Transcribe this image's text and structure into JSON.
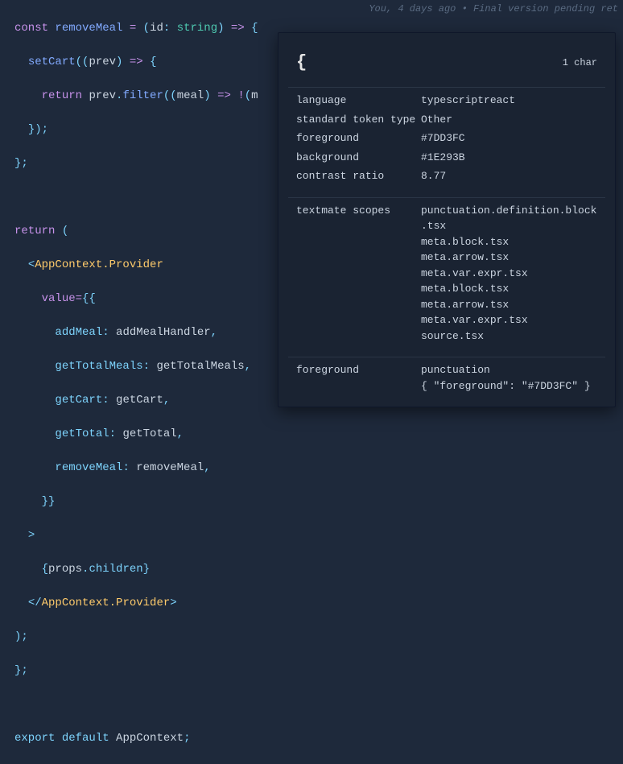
{
  "codeLens": "You, 4 days ago • Final version pending ret",
  "code": {
    "l1": "  const removeMeal = (id: string) => {",
    "l2": "    setCart((prev) => {",
    "l3": "      return prev.filter((meal) => !(m",
    "l4": "    });",
    "l5": "  };",
    "l6": "",
    "l7": "  return (",
    "l8": "    <AppContext.Provider",
    "l9": "      value={{",
    "l10": "        addMeal: addMealHandler,",
    "l11": "        getTotalMeals: getTotalMeals,",
    "l12": "        getCart: getCart,",
    "l13": "        getTotal: getTotal,",
    "l14": "        removeMeal: removeMeal,",
    "l15": "      }}",
    "l16": "    >",
    "l17": "      {props.children}",
    "l18": "    </AppContext.Provider>",
    "l19": "  );",
    "l20": "};",
    "l21": "",
    "l22": "export default AppContext;"
  },
  "inspector": {
    "token": "{",
    "charCount": "1 char",
    "rows1": {
      "language": {
        "k": "language",
        "v": "typescriptreact"
      },
      "stdtoken": {
        "k": "standard token type",
        "v": "Other"
      },
      "foreground": {
        "k": "foreground",
        "v": "#7DD3FC"
      },
      "background": {
        "k": "background",
        "v": "#1E293B"
      },
      "contrast": {
        "k": "contrast ratio",
        "v": "8.77"
      }
    },
    "scopesLabel": "textmate scopes",
    "scopes": [
      "punctuation.definition.block.tsx",
      "meta.block.tsx",
      "meta.arrow.tsx",
      "meta.var.expr.tsx",
      "meta.block.tsx",
      "meta.arrow.tsx",
      "meta.var.expr.tsx",
      "source.tsx"
    ],
    "fgLabel": "foreground",
    "fg1": "punctuation",
    "fg2": "{ \"foreground\": \"#7DD3FC\" }"
  }
}
